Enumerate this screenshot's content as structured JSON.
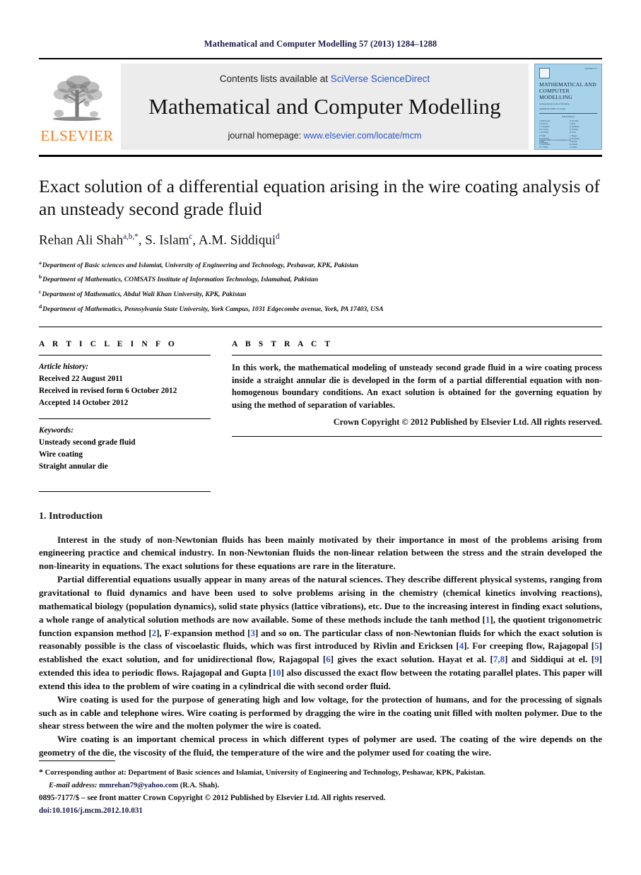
{
  "running_head": "Mathematical and Computer Modelling 57 (2013) 1284–1288",
  "masthead": {
    "publisher_name": "ELSEVIER",
    "contents_prefix": "Contents lists available at ",
    "contents_link": "SciVerse ScienceDirect",
    "journal_title": "Mathematical and Computer Modelling",
    "homepage_prefix": "journal homepage: ",
    "homepage_link": "www.elsevier.com/locate/mcm",
    "cover": {
      "top_left": "MATHEMATICAL AND COMPUTER MODELLING",
      "top_right": "ISSN 0895-7177",
      "title": "MATHEMATICAL AND COMPUTER MODELLING",
      "subtitle_line1": "An International Journal of Modelling",
      "subtitle_line2": "EDITOR-IN-CHIEF: E.Y. Rodin",
      "board_heading": "Editorial Board",
      "col_left": "A. Bensoussan\nJ. D. Brown\nC. Cercignani\nR. E. Ewing\nA. Friedman\nW. Fulks\nR. Glowinski\nJ. Hale\nG. Karniadakis\nH. T. Banks\nM. Kimura\nJ. L. Lions",
      "col_right": "R. Lucchetti\nJ. Mohr\nK. Neumann\nD. Nicholls\nM. Prato\nC. Rogers\nS. Rosenberg\nJ. Smoller\nR. Temam\nG. Wahba\nK. Wang\nJ. Zowe",
      "footer_left": "Available online at www.sciencedirect.com",
      "footer_right": "ELSEVIER"
    }
  },
  "article": {
    "title": "Exact solution of a differential equation arising in the wire coating analysis of an unsteady second grade fluid",
    "authors": [
      {
        "name": "Rehan Ali Shah",
        "sup": "a,b,*"
      },
      {
        "name": "S. Islam",
        "sup": "c"
      },
      {
        "name": "A.M. Siddiqui",
        "sup": "d"
      }
    ],
    "affiliations": [
      {
        "mark": "a",
        "text": "Department of Basic sciences and Islamiat, University of Engineering and Technology, Peshawar, KPK, Pakistan"
      },
      {
        "mark": "b",
        "text": "Department of Mathematics, COMSATS Institute of Information Technology, Islamabad, Pakistan"
      },
      {
        "mark": "c",
        "text": "Department of Mathematics, Abdul Wali Khan University, KPK, Pakistan"
      },
      {
        "mark": "d",
        "text": "Department of Mathematics, Pennsylvania State University, York Campus, 1031 Edgecombe avenue, York, PA 17403, USA"
      }
    ]
  },
  "article_info": {
    "label": "A R T I C L E    I N F O",
    "history_label": "Article history:",
    "history": [
      "Received 22 August 2011",
      "Received in revised form 6 October 2012",
      "Accepted 14 October 2012"
    ],
    "keywords_label": "Keywords:",
    "keywords": [
      "Unsteady second grade fluid",
      "Wire coating",
      "Straight annular die"
    ]
  },
  "abstract": {
    "label": "A B S T R A C T",
    "text": "In this work, the mathematical modeling of unsteady second grade fluid in a wire coating process inside a straight annular die is developed in the form of a partial differential equation with non-homogenous boundary conditions. An exact solution is obtained for the governing equation by using the method of separation of variables.",
    "copyright": "Crown Copyright © 2012 Published by Elsevier Ltd. All rights reserved."
  },
  "introduction": {
    "heading": "1. Introduction",
    "paragraphs": [
      "Interest in the study of non-Newtonian fluids has been mainly motivated by their importance in most of the problems arising from engineering practice and chemical industry. In non-Newtonian fluids the non-linear relation between the stress and the strain developed the non-linearity in equations. The exact solutions for these equations are rare in the literature.",
      "Wire coating is used for the purpose of generating high and low voltage, for the protection of humans, and for the processing of signals such as in cable and telephone wires. Wire coating is performed by dragging the wire in the coating unit filled with molten polymer. Due to the shear stress between the wire and the molten polymer the wire is coated.",
      "Wire coating is an important chemical process in which different types of polymer are used. The coating of the wire depends on the geometry of the die, the viscosity of the fluid, the temperature of the wire and the polymer used for coating the wire."
    ],
    "paragraph_with_citations": {
      "part1": "Partial differential equations usually appear in many areas of the natural sciences. They describe different physical systems, ranging from gravitational to fluid dynamics and have been used to solve problems arising in the chemistry (chemical kinetics involving reactions), mathematical biology (population dynamics), solid state physics (lattice vibrations), etc. Due to the increasing interest in finding exact solutions, a whole range of analytical solution methods are now available. Some of these methods include the tanh method [",
      "c1": "1",
      "part2": "], the quotient trigonometric function expansion method [",
      "c2": "2",
      "part3": "], F-expansion method [",
      "c3": "3",
      "part4": "] and so on. The particular class of non-Newtonian fluids for which the exact solution is reasonably possible is the class of viscoelastic fluids, which was first introduced by Rivlin and Ericksen [",
      "c4": "4",
      "part5": "]. For creeping flow, Rajagopal [",
      "c5": "5",
      "part6": "] established the exact solution, and for unidirectional flow, Rajagopal [",
      "c6": "6",
      "part7": "] gives the exact solution. Hayat et al. [",
      "c7": "7,8",
      "part8": "] and Siddiqui at el. [",
      "c8": "9",
      "part9": "] extended this idea to periodic flows. Rajagopal and Gupta [",
      "c9": "10",
      "part10": "] also discussed the exact flow between the rotating parallel plates. This paper will extend this idea to the problem of wire coating in a cylindrical die with second order fluid."
    }
  },
  "footnotes": {
    "corresponding_mark": "*",
    "corresponding_text": "Corresponding author at: Department of Basic sciences and Islamiat, University of Engineering and Technology, Peshawar, KPK, Pakistan.",
    "email_label": "E-mail address:",
    "email": "mmrehan79@yahoo.com",
    "email_suffix": "(R.A. Shah)."
  },
  "page_footer": {
    "issn_line": "0895-7177/$ – see front matter Crown Copyright © 2012 Published by Elsevier Ltd. All rights reserved.",
    "doi_line": "doi:10.1016/j.mcm.2012.10.031"
  }
}
